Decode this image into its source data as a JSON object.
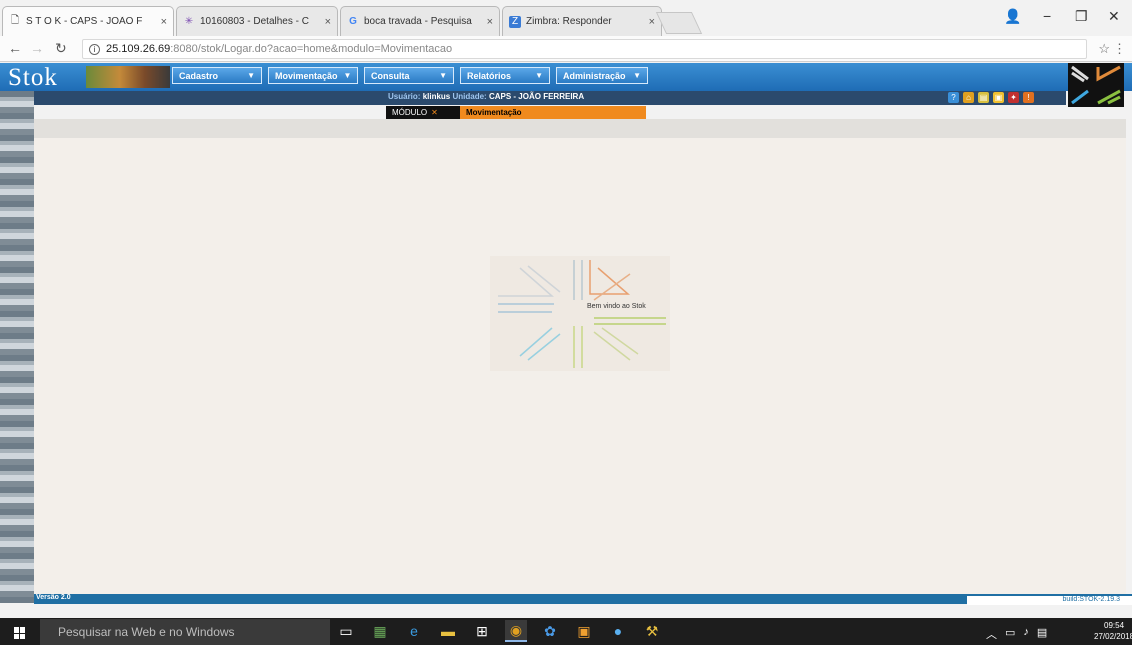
{
  "browser": {
    "tabs": [
      {
        "label": "S T O K - CAPS - JOÃO F",
        "icon": "page-icon",
        "active": true
      },
      {
        "label": "10160803 - Detalhes - C",
        "icon": "star-logo-icon",
        "active": false
      },
      {
        "label": "boca travada - Pesquisa",
        "icon": "google-icon",
        "active": false
      },
      {
        "label": "Zimbra: Responder",
        "icon": "zimbra-icon",
        "active": false
      }
    ],
    "close_glyph": "×",
    "address": {
      "host": "25.109.26.69",
      "path": ":8080/stok/Logar.do?acao=home&modulo=Movimentacao"
    }
  },
  "app": {
    "logo_text": "Stok",
    "menus": [
      {
        "label": "Cadastro"
      },
      {
        "label": "Movimentação"
      },
      {
        "label": "Consulta"
      },
      {
        "label": "Relatórios"
      },
      {
        "label": "Administração"
      }
    ],
    "user_label": "Usuário:",
    "user_value": "klinkus",
    "unit_label": "Unidade:",
    "unit_value": "CAPS - JOÃO FERREIRA",
    "module_label": "MÓDULO",
    "module_name": "Movimentação",
    "welcome_text": "Bem vindo ao Stok",
    "version": "Versão 2.0",
    "build": "build:STOK-2.19.3",
    "tool_icon_colors": [
      "#3a8fd8",
      "#e0a020",
      "#d8c040",
      "#f0c030",
      "#c03030",
      "#e07020"
    ]
  },
  "taskbar": {
    "search_placeholder": "Pesquisar na Web e no Windows",
    "time": "09:54",
    "date": "27/02/2018"
  }
}
